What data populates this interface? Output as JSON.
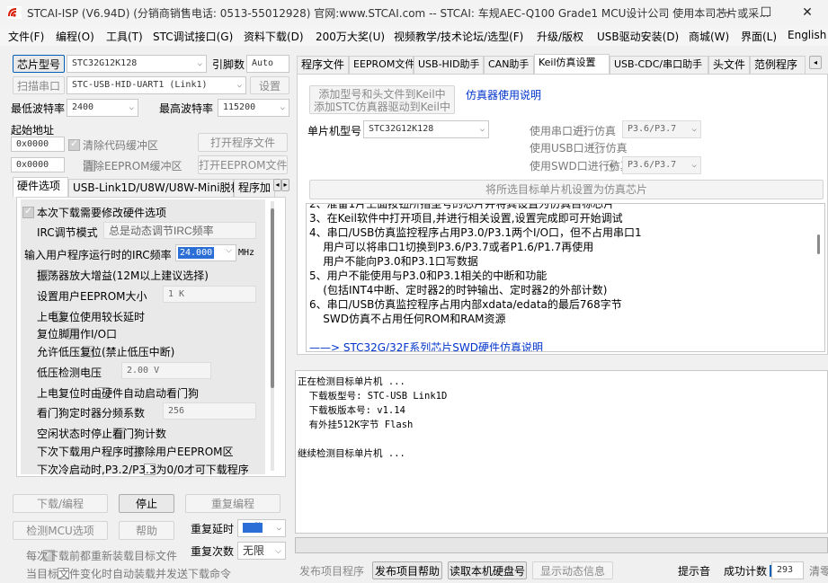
{
  "window": {
    "title": "STCAI-ISP (V6.94D) (分销商销售电话: 0513-55012928) 官网:www.STCAI.com  -- STCAI: 车规AEC-Q100 Grade1 MCU设计公司 使用本司芯片或采...",
    "minimize": "—",
    "maximize": "☐",
    "close": "✕"
  },
  "menu": [
    "文件(F)",
    "编程(O)",
    "工具(T)",
    "STC调试接口(G)",
    "资料下载(D)",
    "200万大奖(U)",
    "视频教学/技术论坛/选型(F)",
    "升级/版权",
    "USB驱动安装(D)",
    "商城(W)",
    "界面(L)",
    "English"
  ],
  "left": {
    "chip_button": "芯片型号",
    "chip_value": "STC32G12K128",
    "pin_label": "引脚数",
    "pin_value": "Auto",
    "scan_button": "扫描串口",
    "port_value": "STC-USB-HID-UART1 (Link1)",
    "settings_button": "设置",
    "min_baud_label": "最低波特率",
    "min_baud_value": "2400",
    "max_baud_label": "最高波特率",
    "max_baud_value": "115200",
    "start_addr_label": "起始地址",
    "addr1_value": "0x0000",
    "clear_code_label": "清除代码缓冲区",
    "open_program_button": "打开程序文件",
    "addr2_value": "0x0000",
    "clear_eeprom_label": "清除EEPROM缓冲区",
    "open_eeprom_button": "打开EEPROM文件"
  },
  "left_tabs": [
    "硬件选项",
    "USB-Link1D/U8W/U8W-Mini脱机",
    "程序加"
  ],
  "hw": {
    "modify_label": "本次下载需要修改硬件选项",
    "irc_mode_label": "IRC调节模式",
    "irc_mode_value": "总是动态调节IRC频率",
    "irc_freq_label": "输入用户程序运行时的IRC频率",
    "irc_freq_value": "24.000",
    "irc_freq_unit": "MHz",
    "osc_gain_label": "振荡器放大增益(12M以上建议选择)",
    "eeprom_size_label": "设置用户EEPROM大小",
    "eeprom_size_value": "1    K",
    "long_reset_label": "上电复位使用较长延时",
    "reset_pin_label": "复位脚用作I/O口",
    "lvd_reset_label": "允许低压复位(禁止低压中断)",
    "lvd_label": "低压检测电压",
    "lvd_value": "2.00 V",
    "wdt_auto_label": "上电复位时由硬件自动启动看门狗",
    "wdt_div_label": "看门狗定时器分频系数",
    "wdt_div_value": "256",
    "wdt_idle_label": "空闲状态时停止看门狗计数",
    "erase_eeprom_label": "下次下载用户程序时擦除用户EEPROM区",
    "p32_label": "下次冷启动时,P3.2/P3.3为0/0才可下载程序"
  },
  "actions": {
    "download": "下载/编程",
    "stop": "停止",
    "reprogram": "重复编程",
    "detect": "检测MCU选项",
    "help": "帮助",
    "repeat_delay_label": "重复延时",
    "repeat_delay_value": "3 秒",
    "repeat_count_label": "重复次数",
    "repeat_count_value": "无限",
    "reload_label": "每次下载前都重新装载目标文件",
    "auto_load_label": "当目标文件变化时自动装载并发送下载命令"
  },
  "right_tabs": [
    "程序文件",
    "EEPROM文件",
    "USB-HID助手",
    "CAN助手",
    "Keil仿真设置",
    "USB-CDC/串口助手",
    "头文件",
    "范例程序"
  ],
  "keil": {
    "add_button_line1": "添加型号和头文件到Keil中",
    "add_button_line2": "添加STC仿真器驱动到Keil中",
    "guide_link": "仿真器使用说明",
    "mcu_label": "单片机型号",
    "mcu_value": "STC32G12K128",
    "serial_radio": "使用串口进行仿真",
    "serial_value": "P3.6/P3.7",
    "usb_radio": "使用USB口进行仿真",
    "swd_radio": "使用SWD口进行仿真",
    "swd_value": "P3.6/P3.7",
    "set_button": "将所选目标单片机设置为仿真芯片"
  },
  "notes": [
    "2、准备1片上面按钮所指型号的芯片并将其设置为仿真目标芯片",
    "3、在Keil软件中打开项目,并进行相关设置,设置完成即可开始调试",
    "4、串口/USB仿真监控程序占用P3.0/P3.1两个I/O口，但不占用串口1",
    "    用户可以将串口1切换到P3.6/P3.7或者P1.6/P1.7再使用",
    "    用户不能向P3.0和P3.1口写数据",
    "5、用户不能使用与P3.0和P3.1相关的中断和功能",
    "    (包括INT4中断、定时器2的时钟输出、定时器2的外部计数)",
    "6、串口/USB仿真监控程序占用内部xdata/edata的最后768字节",
    "    SWD仿真不占用任何ROM和RAM资源",
    "",
    "——> STC32G/32F系列芯片SWD硬件仿真说明"
  ],
  "log": [
    "正在检测目标单片机 ...",
    "  下载板型号: STC-USB Link1D",
    "  下载板版本号: v1.14",
    "  有外挂512K字节 Flash",
    "",
    "继续检测目标单片机 ..."
  ],
  "bottom": {
    "publish": "发布项目程序",
    "publish_help": "发布项目帮助",
    "read_serial": "读取本机硬盘号",
    "show_dynamic": "显示动态信息",
    "beep_label": "提示音",
    "success_label": "成功计数",
    "success_value": "293",
    "clear_label": "清零"
  },
  "colors": {
    "accent": "#005fb8",
    "link": "#0033cc",
    "highlight": "#2b6fd6"
  }
}
